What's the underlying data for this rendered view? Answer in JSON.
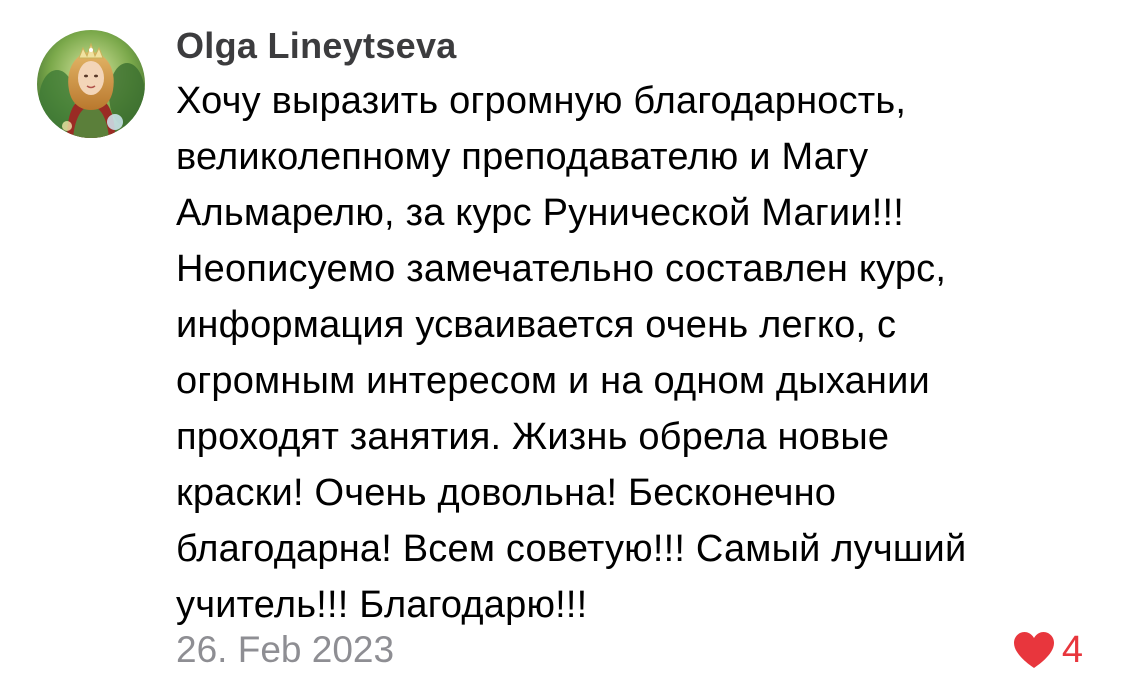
{
  "comment": {
    "author": "Olga Lineytseva",
    "avatar_icon": "avatar-photo-icon",
    "lines": [
      "Хочу выразить огромную благодарность,",
      "великолепному преподавателю и Магу",
      "Альмарелю, за курс Рунической Магии!!!",
      "Неописуемо замечательно составлен курс,",
      "информация усваивается очень легко, с",
      "огромным интересом и на одном дыхании",
      "проходят занятия. Жизнь обрела новые",
      "краски! Очень довольна! Бесконечно",
      "благодарна! Всем советую!!! Самый лучший",
      "учитель!!! Благодарю!!!"
    ],
    "date": "26. Feb 2023",
    "likes": {
      "icon": "heart-icon",
      "count": "4",
      "color": "#e8363d"
    }
  }
}
